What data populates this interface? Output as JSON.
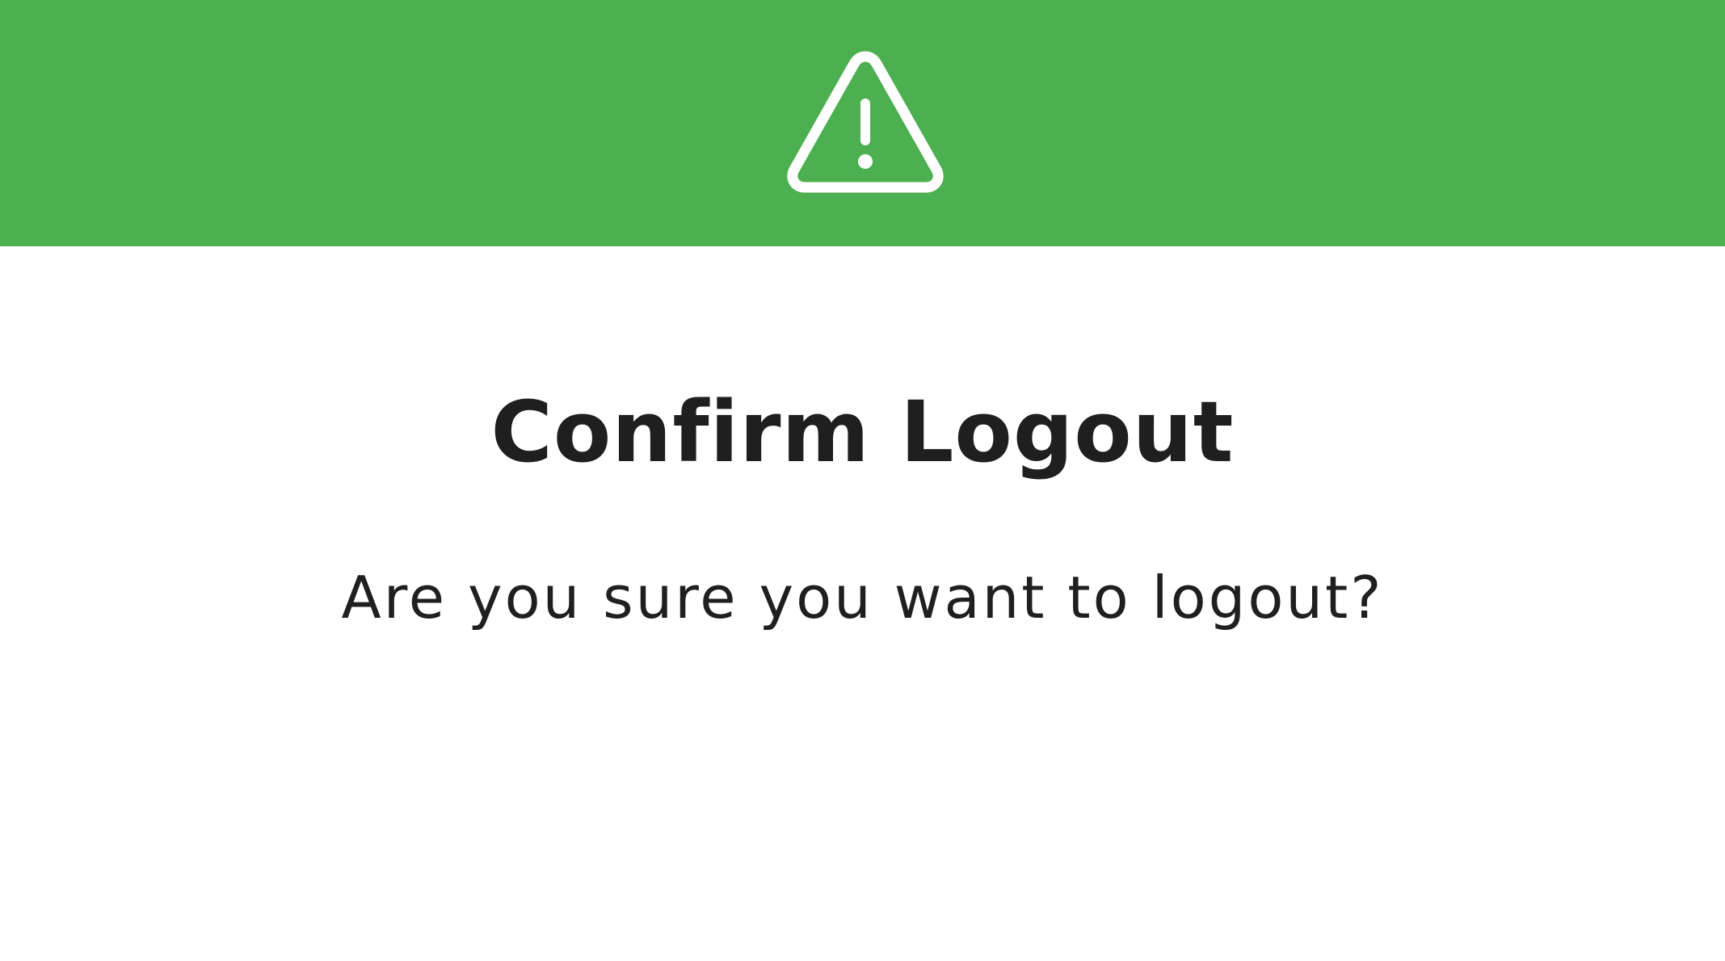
{
  "dialog": {
    "icon": "warning-triangle-icon",
    "title": "Confirm Logout",
    "message": "Are you sure you want to logout?"
  },
  "colors": {
    "header_background": "#4caf50",
    "icon_stroke": "#ffffff",
    "text": "#1f1f1f",
    "body_background": "#ffffff"
  }
}
